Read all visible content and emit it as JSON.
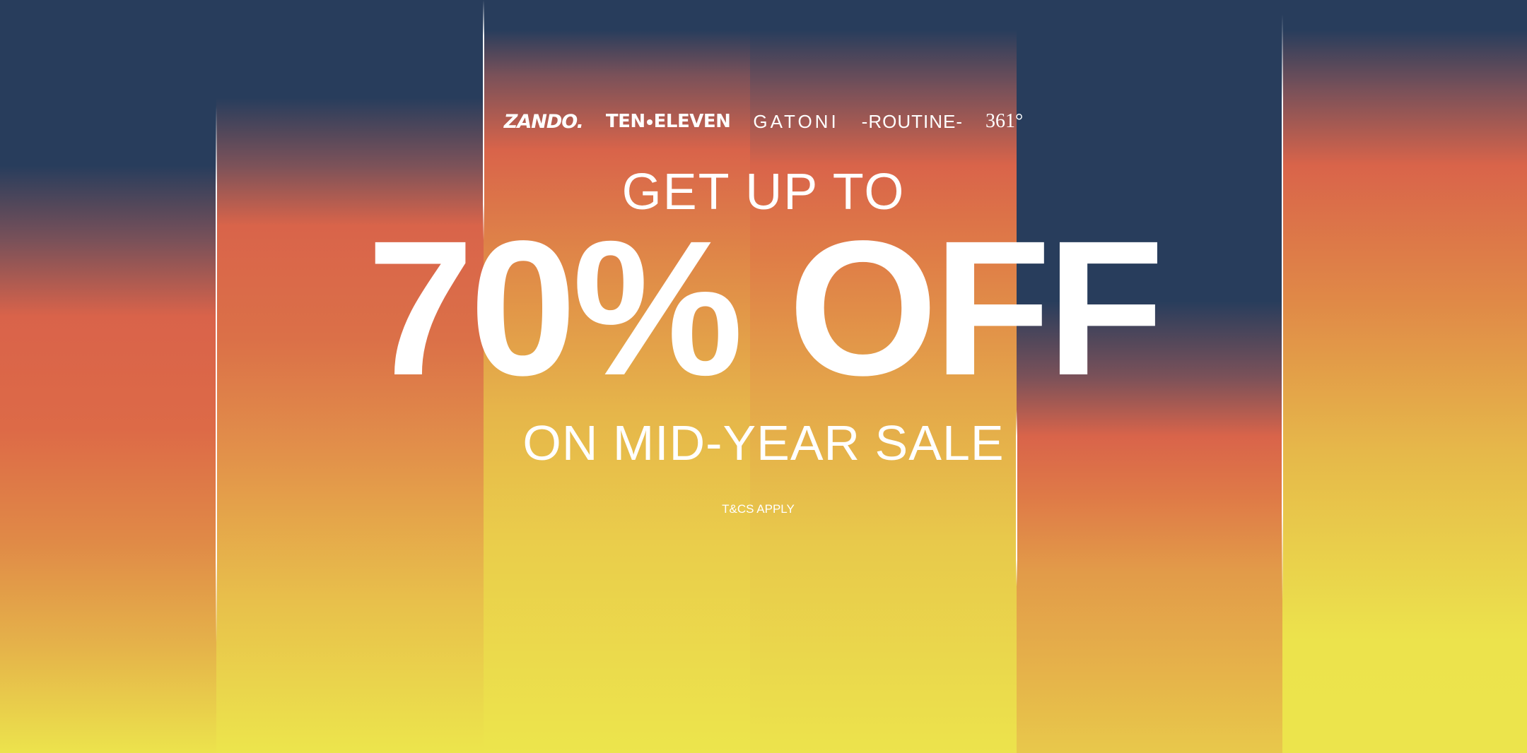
{
  "banner": {
    "logos": [
      {
        "name": "zando",
        "text": "ZANDO."
      },
      {
        "name": "ten-eleven",
        "left": "TEN",
        "right": "ELEVEN"
      },
      {
        "name": "gatoni",
        "text": "GATONI"
      },
      {
        "name": "routine",
        "text": "-ROUTINE-"
      },
      {
        "name": "361",
        "text": "361°"
      }
    ],
    "intro": "GET UP TO",
    "headline": "70% OFF",
    "subline": "ON MID-YEAR SALE",
    "terms": "T&CS APPLY"
  },
  "colors": {
    "navy": "#283d5c",
    "orange": "#d9644a",
    "yellow": "#ece44c",
    "text": "#ffffff"
  }
}
